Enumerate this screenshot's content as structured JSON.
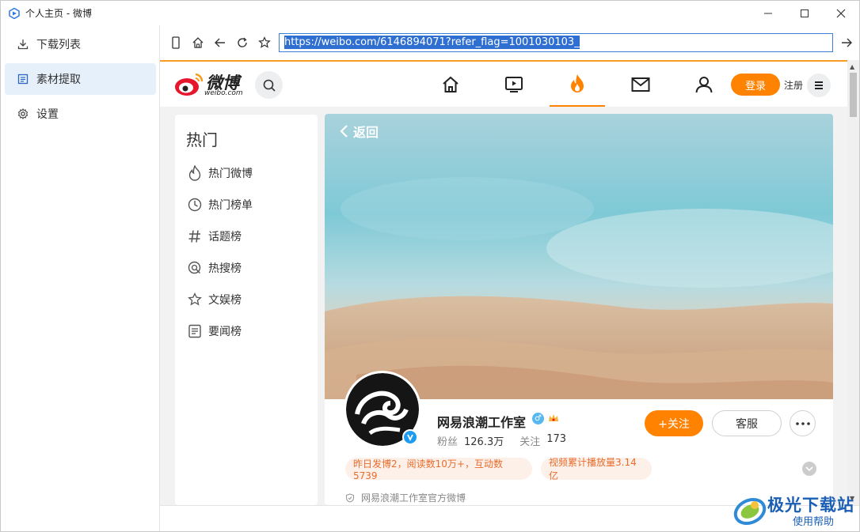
{
  "window": {
    "title": "个人主页 - 微博"
  },
  "sidebar": {
    "items": [
      {
        "label": "下载列表",
        "icon": "download-icon"
      },
      {
        "label": "素材提取",
        "icon": "list-icon",
        "active": true
      },
      {
        "label": "设置",
        "icon": "gear-icon"
      }
    ]
  },
  "addressbar": {
    "url": "https://weibo.com/6146894071?refer_flag=1001030103_"
  },
  "weibo": {
    "logo_text": "微博",
    "logo_sub": "weibo.com",
    "login_label": "登录",
    "register_label": "注册",
    "hot": {
      "title": "热门",
      "items": [
        {
          "label": "热门微博",
          "icon": "flame-icon"
        },
        {
          "label": "热门榜单",
          "icon": "clock-icon"
        },
        {
          "label": "话题榜",
          "icon": "hash-icon"
        },
        {
          "label": "热搜榜",
          "icon": "search-circle-icon"
        },
        {
          "label": "文娱榜",
          "icon": "star-icon"
        },
        {
          "label": "要闻榜",
          "icon": "news-icon"
        }
      ]
    },
    "profile": {
      "back_label": "返回",
      "name": "网易浪潮工作室",
      "fans_label": "粉丝",
      "fans_value": "126.3万",
      "follow_label": "关注",
      "follow_value": "173",
      "follow_button": "+关注",
      "service_button": "客服",
      "tags": [
        "昨日发博2，阅读数10万+，互动数5739",
        "视频累计播放量3.14亿"
      ],
      "official": "网易浪潮工作室官方微博"
    }
  },
  "watermark": {
    "line1": "极光下载站",
    "line2": "使用帮助"
  },
  "colors": {
    "accent": "#ff8200",
    "selected_sidebar": "#e6f0fb",
    "url_highlight": "#2f6fd1"
  }
}
